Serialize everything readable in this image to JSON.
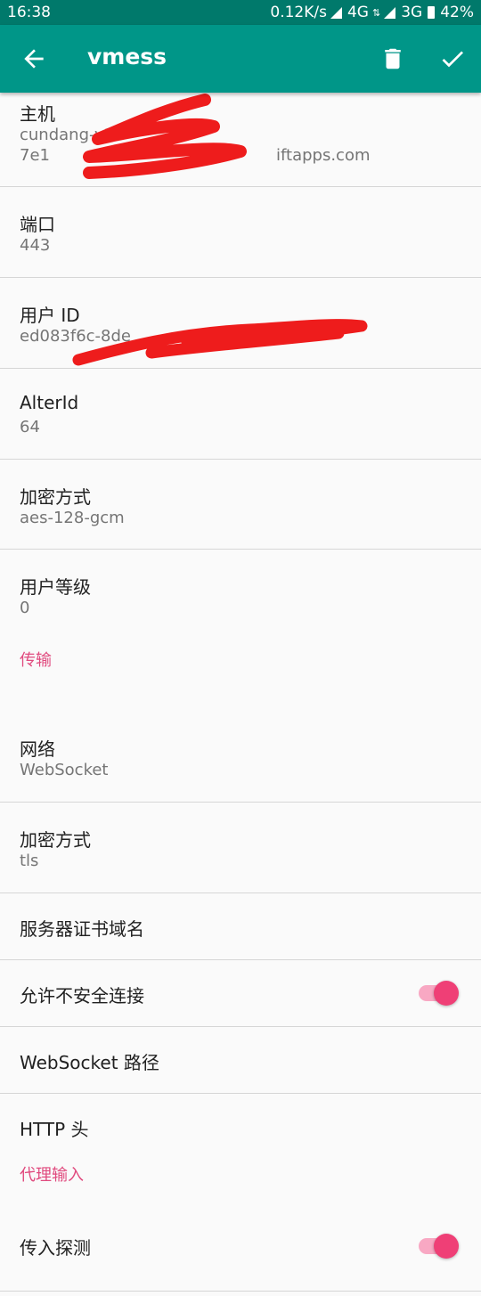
{
  "status_bar": {
    "time": "16:38",
    "speed": "0.12K/s",
    "net1": "4G",
    "net2": "3G",
    "battery": "42%"
  },
  "toolbar": {
    "title": "vmess",
    "back_icon": "arrow-left-icon",
    "delete_icon": "trash-icon",
    "confirm_icon": "check-icon",
    "bg_color": "#009688"
  },
  "server": {
    "host": {
      "label": "主机",
      "value_line1": "cundang-v2r",
      "value_line2": "7e1",
      "value_suffix": "iftapps.com"
    },
    "port": {
      "label": "端口",
      "value": "443"
    },
    "user_id": {
      "label": "用户 ID",
      "value": "ed083f6c-8de"
    },
    "alter_id": {
      "label": "AlterId",
      "value": "64"
    },
    "security": {
      "label": "加密方式",
      "value": "aes-128-gcm"
    },
    "level": {
      "label": "用户等级",
      "value": "0"
    }
  },
  "transport": {
    "section_title": "传输",
    "network": {
      "label": "网络",
      "value": "WebSocket"
    },
    "tls": {
      "label": "加密方式",
      "value": "tls"
    },
    "sni": {
      "label": "服务器证书域名"
    },
    "allow_insecure": {
      "label": "允许不安全连接",
      "enabled": true
    },
    "ws_path": {
      "label": "WebSocket 路径"
    },
    "http_header": {
      "label": "HTTP 头"
    }
  },
  "inbound": {
    "section_title": "代理输入",
    "sniffing": {
      "label": "传入探测",
      "enabled": true
    }
  },
  "colors": {
    "accent": "#ef3f76",
    "category": "#e04a7e",
    "status_bar": "#00796b",
    "redaction": "#ee1c1c"
  }
}
